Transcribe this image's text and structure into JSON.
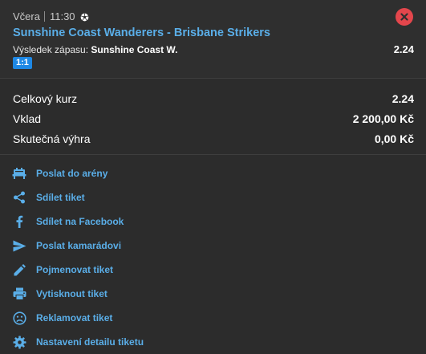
{
  "match": {
    "day": "Včera",
    "time": "11:30",
    "sport_icon": "soccer-ball-icon",
    "title": "Sunshine Coast Wanderers - Brisbane Strikers",
    "market_label": "Výsledek zápasu:",
    "selection": "Sunshine Coast W.",
    "odd": "2.24",
    "score": "1:1",
    "close_icon": "close-icon"
  },
  "summary": {
    "rows": [
      {
        "label": "Celkový kurz",
        "value": "2.24"
      },
      {
        "label": "Vklad",
        "value": "2 200,00 Kč"
      },
      {
        "label": "Skutečná výhra",
        "value": "0,00 Kč"
      }
    ]
  },
  "actions": [
    {
      "label": "Poslat do arény",
      "icon": "arena-icon"
    },
    {
      "label": "Sdílet tiket",
      "icon": "share-icon"
    },
    {
      "label": "Sdílet na Facebook",
      "icon": "facebook-icon"
    },
    {
      "label": "Poslat kamarádovi",
      "icon": "send-icon"
    },
    {
      "label": "Pojmenovat tiket",
      "icon": "pencil-icon"
    },
    {
      "label": "Vytisknout tiket",
      "icon": "printer-icon"
    },
    {
      "label": "Reklamovat tiket",
      "icon": "sad-face-icon"
    },
    {
      "label": "Nastavení detailu tiketu",
      "icon": "gear-icon"
    }
  ],
  "colors": {
    "accent": "#5aaee8",
    "icon": "#5aaee8",
    "close": "#e3464c",
    "badge": "#1e88e5",
    "background": "#2c2c2c"
  }
}
